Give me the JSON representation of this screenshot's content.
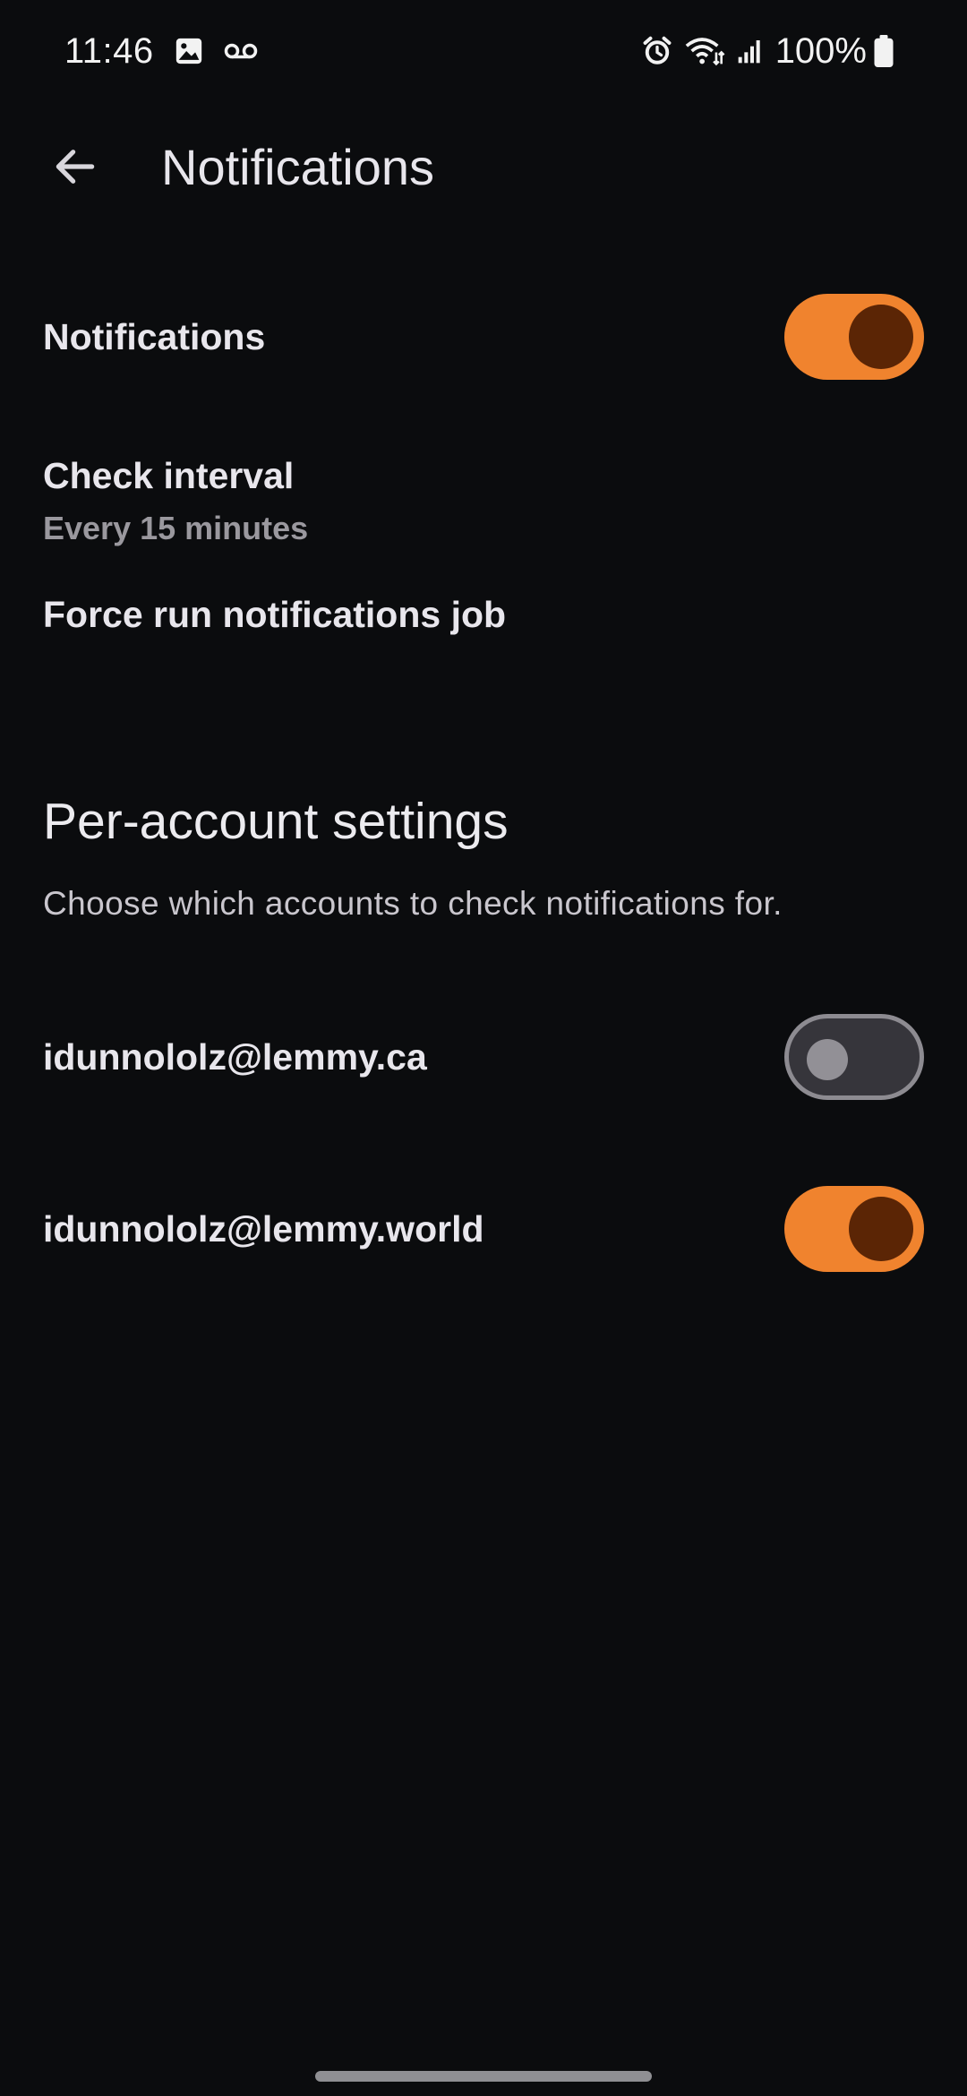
{
  "status_bar": {
    "time": "11:46",
    "left_icons": [
      "gallery-icon",
      "voicemail-icon"
    ],
    "right_icons": [
      "alarm-icon",
      "wifi-icon",
      "signal-icon"
    ],
    "battery_text": "100%"
  },
  "toolbar": {
    "back_icon": "arrow-left-icon",
    "title": "Notifications"
  },
  "settings": {
    "notifications": {
      "label": "Notifications",
      "enabled": true
    },
    "check_interval": {
      "label": "Check interval",
      "value": "Every 15 minutes"
    },
    "force_run": {
      "label": "Force run notifications job"
    }
  },
  "per_account": {
    "title": "Per-account settings",
    "description": "Choose which accounts to check notifications for.",
    "accounts": [
      {
        "name": "idunnololz@lemmy.ca",
        "enabled": false
      },
      {
        "name": "idunnololz@lemmy.world",
        "enabled": true
      }
    ]
  },
  "colors": {
    "background": "#0b0c0e",
    "switch_on_track": "#f0832e",
    "switch_on_thumb": "#5b2505",
    "switch_off_track": "#36353b",
    "switch_off_border": "#8d8b91"
  }
}
